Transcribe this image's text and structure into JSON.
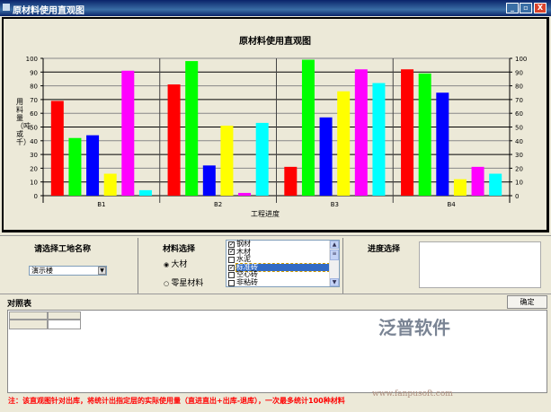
{
  "window": {
    "title": "原材料使用直观图",
    "buttons": [
      "_",
      "▫",
      "X"
    ]
  },
  "chart_data": {
    "type": "bar",
    "title": "原材料使用直观图",
    "xlabel": "工程进度",
    "ylabel": "用料量（吨或千）",
    "categories": [
      "B1",
      "B2",
      "B3",
      "B4"
    ],
    "ylim": [
      0,
      100
    ],
    "yticks": [
      0,
      10,
      20,
      30,
      40,
      50,
      60,
      70,
      80,
      90,
      100
    ],
    "grid": true,
    "colors": [
      "#ff0000",
      "#00ff00",
      "#0000ff",
      "#ffff00",
      "#ff00ff",
      "#00ffff"
    ],
    "series": [
      {
        "values": [
          69,
          81,
          21,
          92
        ]
      },
      {
        "values": [
          42,
          98,
          99,
          89
        ]
      },
      {
        "values": [
          44,
          22,
          57,
          75
        ]
      },
      {
        "values": [
          16,
          51,
          76,
          12
        ]
      },
      {
        "values": [
          91,
          2,
          92,
          21
        ]
      },
      {
        "values": [
          4,
          53,
          82,
          16
        ]
      }
    ]
  },
  "filters": {
    "site_label": "请选择工地名称",
    "site_value": "演示楼",
    "material_label": "材料选择",
    "radio_main": "大材",
    "radio_minor": "零星材料",
    "materials": [
      {
        "label": "钢材",
        "checked": true
      },
      {
        "label": "木材",
        "checked": true
      },
      {
        "label": "水泥",
        "checked": false
      },
      {
        "label": "标准砖",
        "checked": true,
        "selected": true
      },
      {
        "label": "空心砖",
        "checked": false
      },
      {
        "label": "非粘砖",
        "checked": false
      }
    ],
    "progress_label": "进度选择"
  },
  "table": {
    "label": "对照表",
    "confirm": "确定"
  },
  "note": "注：该直观图针对出库，将统计出指定层的实际使用量（直进直出+出库-退库），一次最多统计100种材料",
  "watermark": {
    "brand": "泛普软件",
    "url": "www.fanpusoft.com"
  }
}
